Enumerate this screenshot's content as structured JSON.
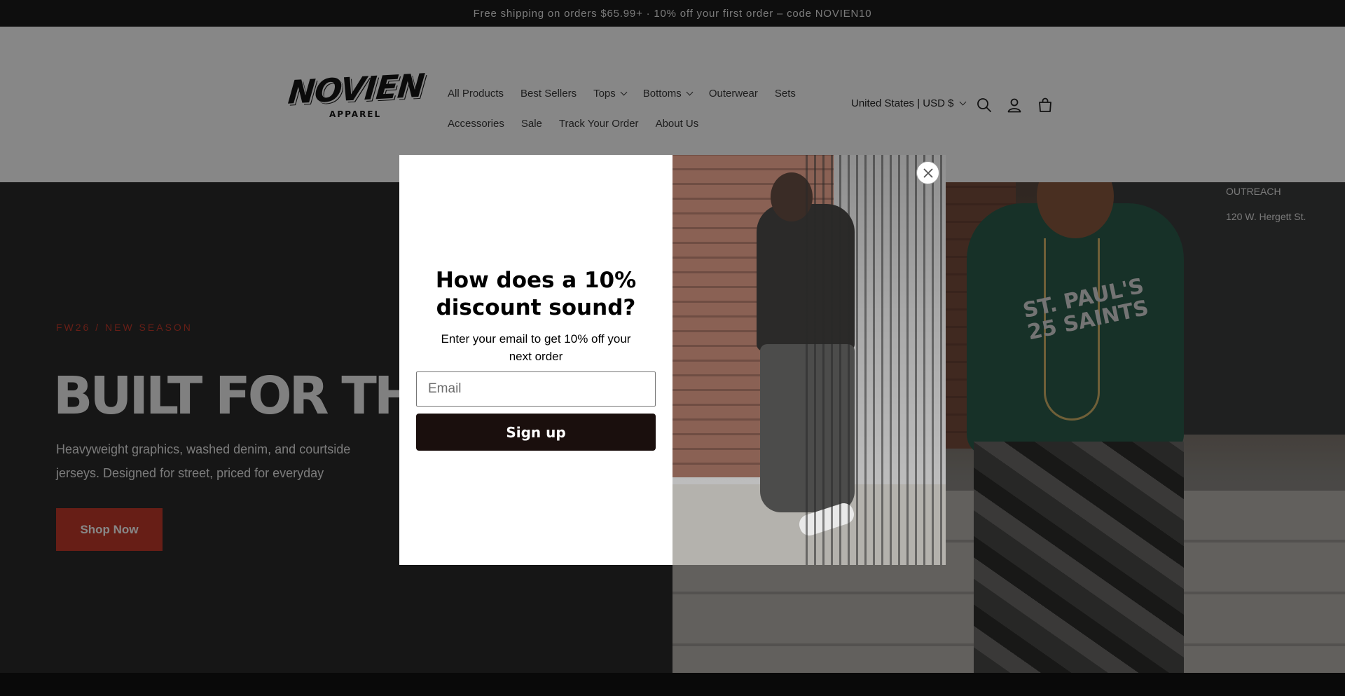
{
  "announcement": {
    "text": "Free shipping on orders $65.99+ · 10% off your first order – code NOVIEN10"
  },
  "header": {
    "logo": {
      "wordmark": "NOVIEN",
      "subtext": "APPAREL"
    },
    "nav_row_1": [
      {
        "label": "All Products",
        "dropdown": false
      },
      {
        "label": "Best Sellers",
        "dropdown": false
      },
      {
        "label": "Tops",
        "dropdown": true
      },
      {
        "label": "Bottoms",
        "dropdown": true
      },
      {
        "label": "Outerwear",
        "dropdown": false
      },
      {
        "label": "Sets",
        "dropdown": false
      }
    ],
    "nav_row_2": [
      {
        "label": "Accessories",
        "dropdown": false
      },
      {
        "label": "Sale",
        "dropdown": false
      },
      {
        "label": "Track Your Order",
        "dropdown": false
      },
      {
        "label": "About Us",
        "dropdown": false
      }
    ],
    "locale": "United States | USD $",
    "icons": [
      "search-icon",
      "account-icon",
      "cart-icon"
    ]
  },
  "hero": {
    "eyebrow": "FW26 / NEW SEASON",
    "headline": "BUILT FOR THE STREETS",
    "subcopy": "Heavyweight graphics, washed denim, and courtside jerseys. Designed for street, priced for everyday",
    "cta": "Shop Now",
    "photo_print": "ST. PAUL'S 25 SAINTS",
    "photo_sign": [
      "OUTREACH",
      "120 W. Hergett St."
    ]
  },
  "popup": {
    "title": "How does a 10% discount sound?",
    "subtitle": "Enter your email to get 10% off your next order",
    "email_placeholder": "Email",
    "email_value": "",
    "submit_label": "Sign up"
  },
  "colors": {
    "accent": "#c23a2b",
    "header_bg": "#ffffff",
    "hero_bg": "#2a2a2a",
    "announcement_bg": "#1b1b1b",
    "signup_button_bg": "#1a0f0d",
    "overlay": "rgba(0,0,0,0.47)"
  }
}
